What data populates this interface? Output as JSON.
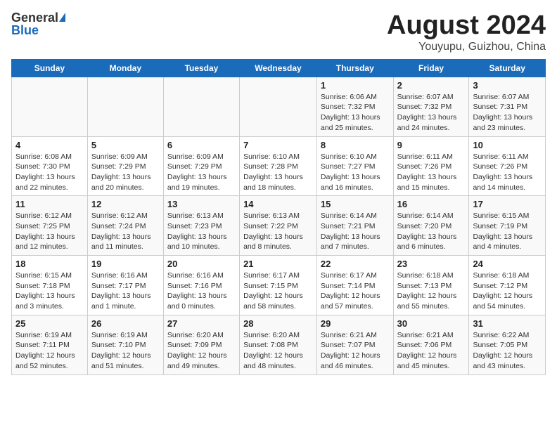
{
  "header": {
    "logo_general": "General",
    "logo_blue": "Blue",
    "title": "August 2024",
    "location": "Youyupu, Guizhou, China"
  },
  "weekdays": [
    "Sunday",
    "Monday",
    "Tuesday",
    "Wednesday",
    "Thursday",
    "Friday",
    "Saturday"
  ],
  "weeks": [
    [
      {
        "day": "",
        "detail": ""
      },
      {
        "day": "",
        "detail": ""
      },
      {
        "day": "",
        "detail": ""
      },
      {
        "day": "",
        "detail": ""
      },
      {
        "day": "1",
        "detail": "Sunrise: 6:06 AM\nSunset: 7:32 PM\nDaylight: 13 hours and 25 minutes."
      },
      {
        "day": "2",
        "detail": "Sunrise: 6:07 AM\nSunset: 7:32 PM\nDaylight: 13 hours and 24 minutes."
      },
      {
        "day": "3",
        "detail": "Sunrise: 6:07 AM\nSunset: 7:31 PM\nDaylight: 13 hours and 23 minutes."
      }
    ],
    [
      {
        "day": "4",
        "detail": "Sunrise: 6:08 AM\nSunset: 7:30 PM\nDaylight: 13 hours and 22 minutes."
      },
      {
        "day": "5",
        "detail": "Sunrise: 6:09 AM\nSunset: 7:29 PM\nDaylight: 13 hours and 20 minutes."
      },
      {
        "day": "6",
        "detail": "Sunrise: 6:09 AM\nSunset: 7:29 PM\nDaylight: 13 hours and 19 minutes."
      },
      {
        "day": "7",
        "detail": "Sunrise: 6:10 AM\nSunset: 7:28 PM\nDaylight: 13 hours and 18 minutes."
      },
      {
        "day": "8",
        "detail": "Sunrise: 6:10 AM\nSunset: 7:27 PM\nDaylight: 13 hours and 16 minutes."
      },
      {
        "day": "9",
        "detail": "Sunrise: 6:11 AM\nSunset: 7:26 PM\nDaylight: 13 hours and 15 minutes."
      },
      {
        "day": "10",
        "detail": "Sunrise: 6:11 AM\nSunset: 7:26 PM\nDaylight: 13 hours and 14 minutes."
      }
    ],
    [
      {
        "day": "11",
        "detail": "Sunrise: 6:12 AM\nSunset: 7:25 PM\nDaylight: 13 hours and 12 minutes."
      },
      {
        "day": "12",
        "detail": "Sunrise: 6:12 AM\nSunset: 7:24 PM\nDaylight: 13 hours and 11 minutes."
      },
      {
        "day": "13",
        "detail": "Sunrise: 6:13 AM\nSunset: 7:23 PM\nDaylight: 13 hours and 10 minutes."
      },
      {
        "day": "14",
        "detail": "Sunrise: 6:13 AM\nSunset: 7:22 PM\nDaylight: 13 hours and 8 minutes."
      },
      {
        "day": "15",
        "detail": "Sunrise: 6:14 AM\nSunset: 7:21 PM\nDaylight: 13 hours and 7 minutes."
      },
      {
        "day": "16",
        "detail": "Sunrise: 6:14 AM\nSunset: 7:20 PM\nDaylight: 13 hours and 6 minutes."
      },
      {
        "day": "17",
        "detail": "Sunrise: 6:15 AM\nSunset: 7:19 PM\nDaylight: 13 hours and 4 minutes."
      }
    ],
    [
      {
        "day": "18",
        "detail": "Sunrise: 6:15 AM\nSunset: 7:18 PM\nDaylight: 13 hours and 3 minutes."
      },
      {
        "day": "19",
        "detail": "Sunrise: 6:16 AM\nSunset: 7:17 PM\nDaylight: 13 hours and 1 minute."
      },
      {
        "day": "20",
        "detail": "Sunrise: 6:16 AM\nSunset: 7:16 PM\nDaylight: 13 hours and 0 minutes."
      },
      {
        "day": "21",
        "detail": "Sunrise: 6:17 AM\nSunset: 7:15 PM\nDaylight: 12 hours and 58 minutes."
      },
      {
        "day": "22",
        "detail": "Sunrise: 6:17 AM\nSunset: 7:14 PM\nDaylight: 12 hours and 57 minutes."
      },
      {
        "day": "23",
        "detail": "Sunrise: 6:18 AM\nSunset: 7:13 PM\nDaylight: 12 hours and 55 minutes."
      },
      {
        "day": "24",
        "detail": "Sunrise: 6:18 AM\nSunset: 7:12 PM\nDaylight: 12 hours and 54 minutes."
      }
    ],
    [
      {
        "day": "25",
        "detail": "Sunrise: 6:19 AM\nSunset: 7:11 PM\nDaylight: 12 hours and 52 minutes."
      },
      {
        "day": "26",
        "detail": "Sunrise: 6:19 AM\nSunset: 7:10 PM\nDaylight: 12 hours and 51 minutes."
      },
      {
        "day": "27",
        "detail": "Sunrise: 6:20 AM\nSunset: 7:09 PM\nDaylight: 12 hours and 49 minutes."
      },
      {
        "day": "28",
        "detail": "Sunrise: 6:20 AM\nSunset: 7:08 PM\nDaylight: 12 hours and 48 minutes."
      },
      {
        "day": "29",
        "detail": "Sunrise: 6:21 AM\nSunset: 7:07 PM\nDaylight: 12 hours and 46 minutes."
      },
      {
        "day": "30",
        "detail": "Sunrise: 6:21 AM\nSunset: 7:06 PM\nDaylight: 12 hours and 45 minutes."
      },
      {
        "day": "31",
        "detail": "Sunrise: 6:22 AM\nSunset: 7:05 PM\nDaylight: 12 hours and 43 minutes."
      }
    ]
  ]
}
